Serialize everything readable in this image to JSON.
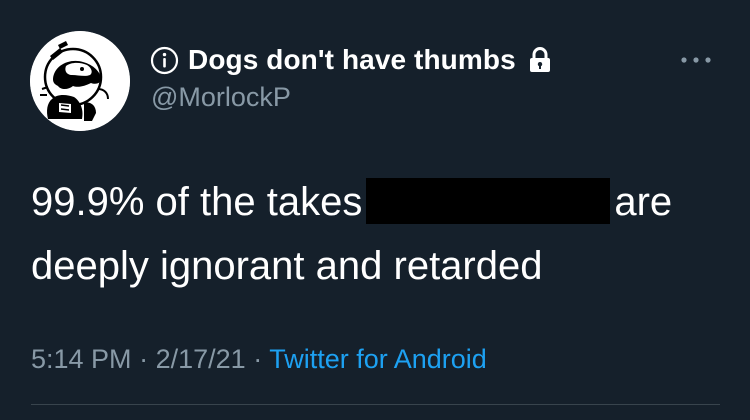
{
  "tweet": {
    "display_name": "Dogs don't have thumbs",
    "handle": "@MorlockP",
    "text_line1_before": "99.9% of the takes",
    "text_line1_after": "are",
    "text_line2": "deeply ignorant and retarded",
    "time": "5:14 PM",
    "date": "2/17/21",
    "separator": "·",
    "source": "Twitter for Android"
  },
  "icons": {
    "name_prefix": "info-icon",
    "protected": "lock-icon",
    "menu": "more-icon",
    "profile": "avatar"
  },
  "colors": {
    "background": "#15202b",
    "primary_text": "#ffffff",
    "secondary_text": "#8899a6",
    "link": "#1da1f2",
    "redaction": "#000000"
  }
}
